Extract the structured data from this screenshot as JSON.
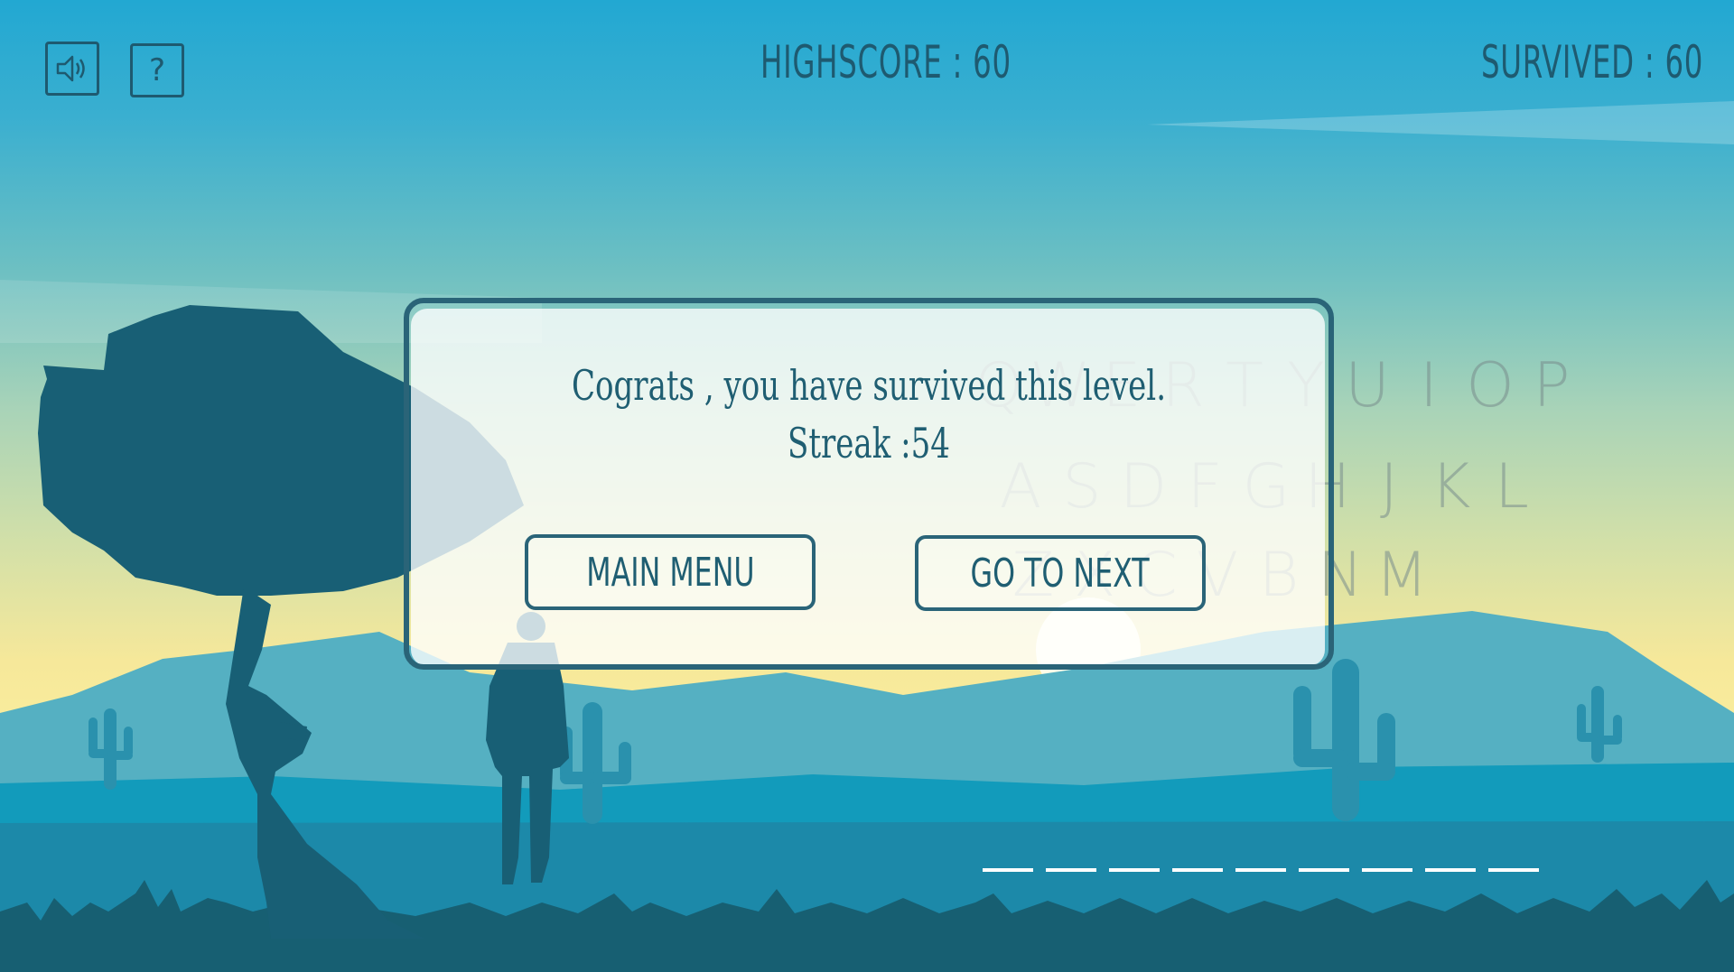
{
  "hud": {
    "highscore": "HIGHSCORE : 60",
    "survived": "SURVIVED : 60",
    "help_label": "?",
    "sound_icon": "speaker-icon"
  },
  "dialog": {
    "message_line1": "Cograts , you have survived this level.",
    "message_line2": "Streak :54",
    "main_menu_label": "MAIN MENU",
    "next_label": "GO TO NEXT"
  },
  "keyboard": {
    "row1": [
      "Q",
      "W",
      "E",
      "R",
      "T",
      "Y",
      "U",
      "I",
      "O",
      "P"
    ],
    "row2": [
      "A",
      "S",
      "D",
      "F",
      "G",
      "H",
      "J",
      "K",
      "L"
    ],
    "row3": [
      "Z",
      "X",
      "C",
      "V",
      "B",
      "N",
      "M"
    ]
  },
  "word_blanks": 9,
  "colors": {
    "ink": "#1e5a70",
    "sky_top": "#22a8d2",
    "horizon": "#f9ec9c",
    "silhouette": "#185f75"
  }
}
